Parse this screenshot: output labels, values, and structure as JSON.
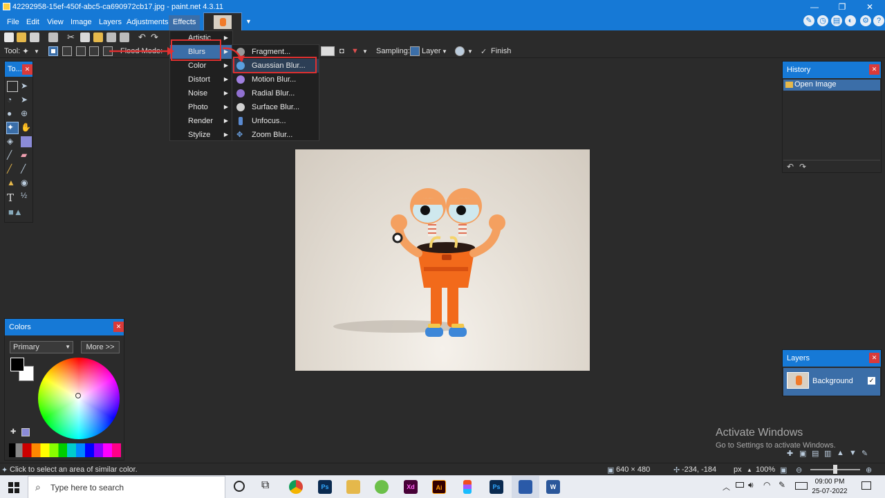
{
  "window": {
    "title": "42292958-15ef-450f-abc5-ca690972cb17.jpg - paint.net 4.3.11"
  },
  "menubar": {
    "items": [
      "File",
      "Edit",
      "View",
      "Image",
      "Layers",
      "Adjustments",
      "Effects"
    ]
  },
  "toolbar": {
    "tool_label": "Tool:",
    "flood_mode_label": "Flood Mode:",
    "sampling_label": "Sampling:",
    "sampling_value": "Layer",
    "finish_label": "Finish"
  },
  "effects_menu": {
    "items": [
      "Artistic",
      "Blurs",
      "Color",
      "Distort",
      "Noise",
      "Photo",
      "Render",
      "Stylize"
    ],
    "highlighted": "Blurs"
  },
  "blurs_menu": {
    "items": [
      "Fragment...",
      "Gaussian Blur...",
      "Motion Blur...",
      "Radial Blur...",
      "Surface Blur...",
      "Unfocus...",
      "Zoom Blur..."
    ],
    "highlighted": "Gaussian Blur..."
  },
  "tools_panel": {
    "title": "To..."
  },
  "history_panel": {
    "title": "History",
    "items": [
      "Open Image"
    ]
  },
  "colors_panel": {
    "title": "Colors",
    "mode": "Primary",
    "more_label": "More >>"
  },
  "layers_panel": {
    "title": "Layers",
    "layers": [
      "Background"
    ]
  },
  "statusbar": {
    "hint": "Click to select an area of similar color.",
    "image_size": "640 × 480",
    "cursor_pos": "-234, -184",
    "units": "px",
    "zoom": "100%"
  },
  "watermark": {
    "line1": "Activate Windows",
    "line2": "Go to Settings to activate Windows."
  },
  "taskbar": {
    "search_placeholder": "Type here to search",
    "time": "09:00 PM",
    "date": "25-07-2022",
    "apps": [
      "Ps",
      "Xd",
      "Ai",
      "Ps",
      "W"
    ]
  },
  "colors": {
    "accent": "#1679d6",
    "selection": "#3b6ea8",
    "highlight_box": "#e03030"
  }
}
